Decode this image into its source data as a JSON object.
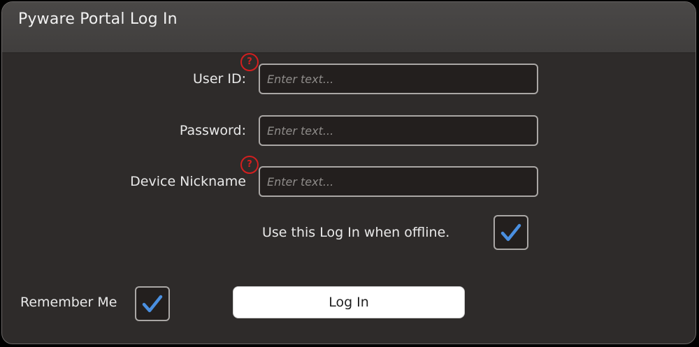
{
  "window": {
    "title": "Pyware Portal Log In"
  },
  "form": {
    "user_id": {
      "label": "User ID:",
      "placeholder": "Enter text...",
      "value": "",
      "help_icon": "?"
    },
    "password": {
      "label": "Password:",
      "placeholder": "Enter text...",
      "value": ""
    },
    "device_nickname": {
      "label": "Device Nickname",
      "placeholder": "Enter text...",
      "value": "",
      "help_icon": "?"
    },
    "offline": {
      "label": "Use this Log In when offline.",
      "checked": true
    },
    "remember_me": {
      "label": "Remember Me",
      "checked": true
    },
    "login_button": "Log In"
  },
  "colors": {
    "background": "#2e2b2a",
    "titlebar": "#454342",
    "field_bg": "#231f1e",
    "field_border": "#aaa7a5",
    "help_red": "#d41f1f",
    "check_blue": "#4a8fe0",
    "button_bg": "#ffffff"
  },
  "icons": {
    "help": "question-circle-icon",
    "check": "checkmark-icon"
  }
}
